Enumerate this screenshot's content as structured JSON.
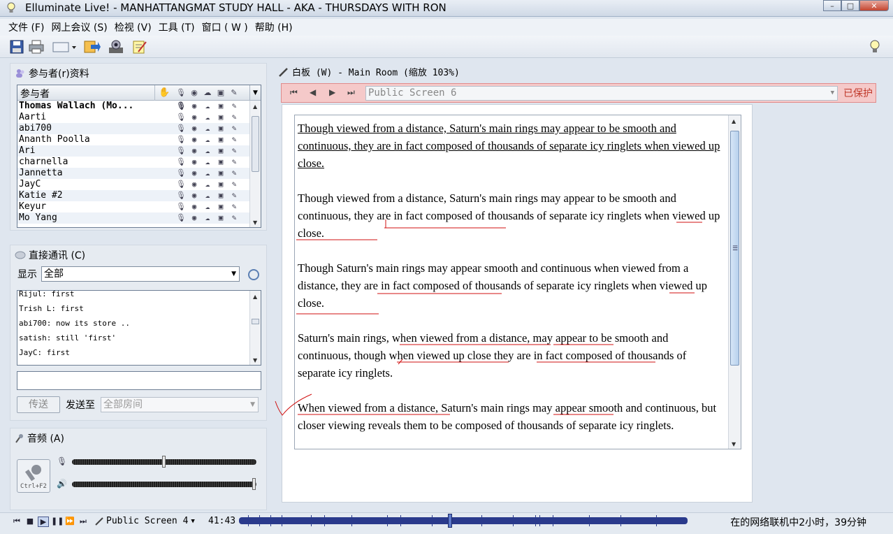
{
  "window": {
    "title": "Elluminate Live! - MANHATTANGMAT STUDY HALL - AKA - THURSDAYS WITH RON"
  },
  "menu": [
    "文件 (F)",
    "网上会议 (S)",
    "检视 (V)",
    "工具 (T)",
    "窗口 ( W )",
    "帮助 (H)"
  ],
  "participants": {
    "title": "参与者(r)资料",
    "header": "参与者",
    "list": [
      "Thomas Wallach (Mo...",
      "Aarti",
      "abi700",
      "Ananth Poolla",
      "Ari",
      "charnella",
      "Jannetta",
      "JayC",
      "Katie #2",
      "Keyur",
      "Mo Yang"
    ]
  },
  "chat": {
    "title": "直接通讯 (C)",
    "show_label": "显示",
    "show_value": "全部",
    "messages": [
      "Rijul: first",
      "Trish L: first",
      "abi700: now its store ..",
      "satish: still 'first'",
      "JayC: first"
    ],
    "send_label": "传送",
    "send_to_label": "发送至",
    "send_to_value": "全部房间"
  },
  "audio": {
    "title": "音频 (A)",
    "mic_shortcut": "Ctrl+F2",
    "mic_level": 0.5,
    "speaker_level": 1.0
  },
  "whiteboard": {
    "title": "白板 (W) - Main Room (缩放 103%)",
    "screen": "Public Screen 6",
    "protected": "已保护",
    "paragraphs": [
      "Though viewed from a distance, Saturn's main rings may appear to be smooth and continuous, they are in fact composed of thousands of separate icy ringlets when viewed up close.",
      "Though viewed from a distance, Saturn's main rings may appear to be smooth and continuous, they are in fact composed of thousands of separate icy ringlets when viewed up close.",
      "Though Saturn's main rings may appear smooth and continuous when viewed from a distance, they are in fact composed of thousands of separate icy ringlets when viewed up close.",
      "Saturn's main rings, when viewed from a distance, may appear to be smooth and continuous, though when viewed up close they are in fact composed of thousands of separate icy ringlets.",
      "When viewed from a distance, Saturn's main rings may appear smooth and continuous, but closer viewing reveals them to be composed of thousands of separate icy ringlets."
    ]
  },
  "playback": {
    "screen": "Public Screen 4",
    "time": "41:43",
    "progress": 0.47,
    "status": "在的网络联机中2小时，39分钟"
  },
  "colors": {
    "accent": "#2a3a8c",
    "protected": "#c0392b",
    "annotation": "#d01010"
  }
}
